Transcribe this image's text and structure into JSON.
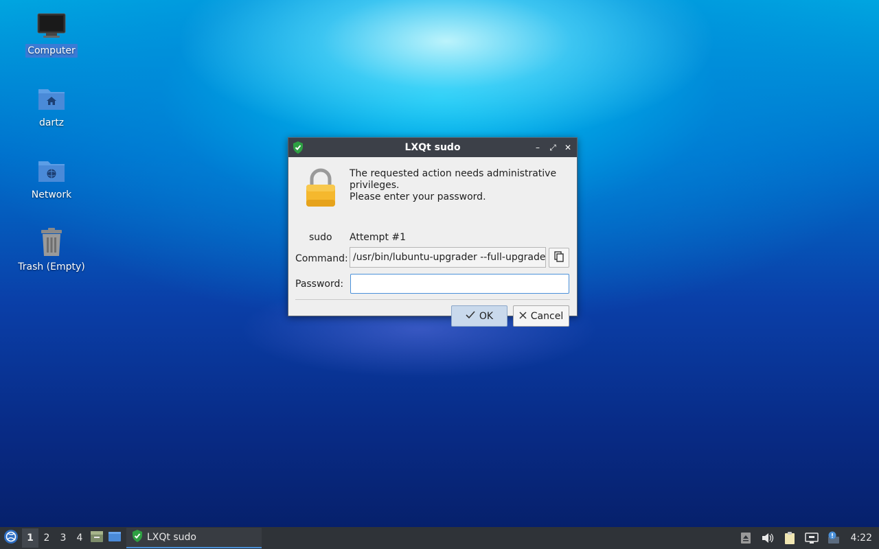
{
  "desktop": {
    "icons": [
      {
        "label": "Computer",
        "icon": "computer-icon",
        "selected": true
      },
      {
        "label": "dartz",
        "icon": "home-folder-icon"
      },
      {
        "label": "Network",
        "icon": "network-folder-icon"
      },
      {
        "label": "Trash (Empty)",
        "icon": "trash-icon"
      }
    ]
  },
  "dialog": {
    "title": "LXQt sudo",
    "icon": "shield-check-icon",
    "controls": {
      "minimize": "–",
      "maximize": "⤢",
      "close": "✕"
    },
    "lock_caption": "sudo",
    "message_line1": "The requested action needs administrative",
    "message_line2": "privileges.",
    "message_line3": "Please enter your password.",
    "attempt": "Attempt #1",
    "command_label": "Command:",
    "command_value": "/usr/bin/lubuntu-upgrader --full-upgrade",
    "password_label": "Password:",
    "password_value": "",
    "ok_label": "OK",
    "cancel_label": "Cancel"
  },
  "taskbar": {
    "workspaces": [
      "1",
      "2",
      "3",
      "4"
    ],
    "active_workspace": "1",
    "task_label": "LXQt sudo",
    "clock": "4:22"
  },
  "colors": {
    "accent": "#4a90d9",
    "titlebar": "#3c4048",
    "taskbar": "#2f3338",
    "lock_body": "#f5b82e",
    "shield": "#2ea043"
  }
}
